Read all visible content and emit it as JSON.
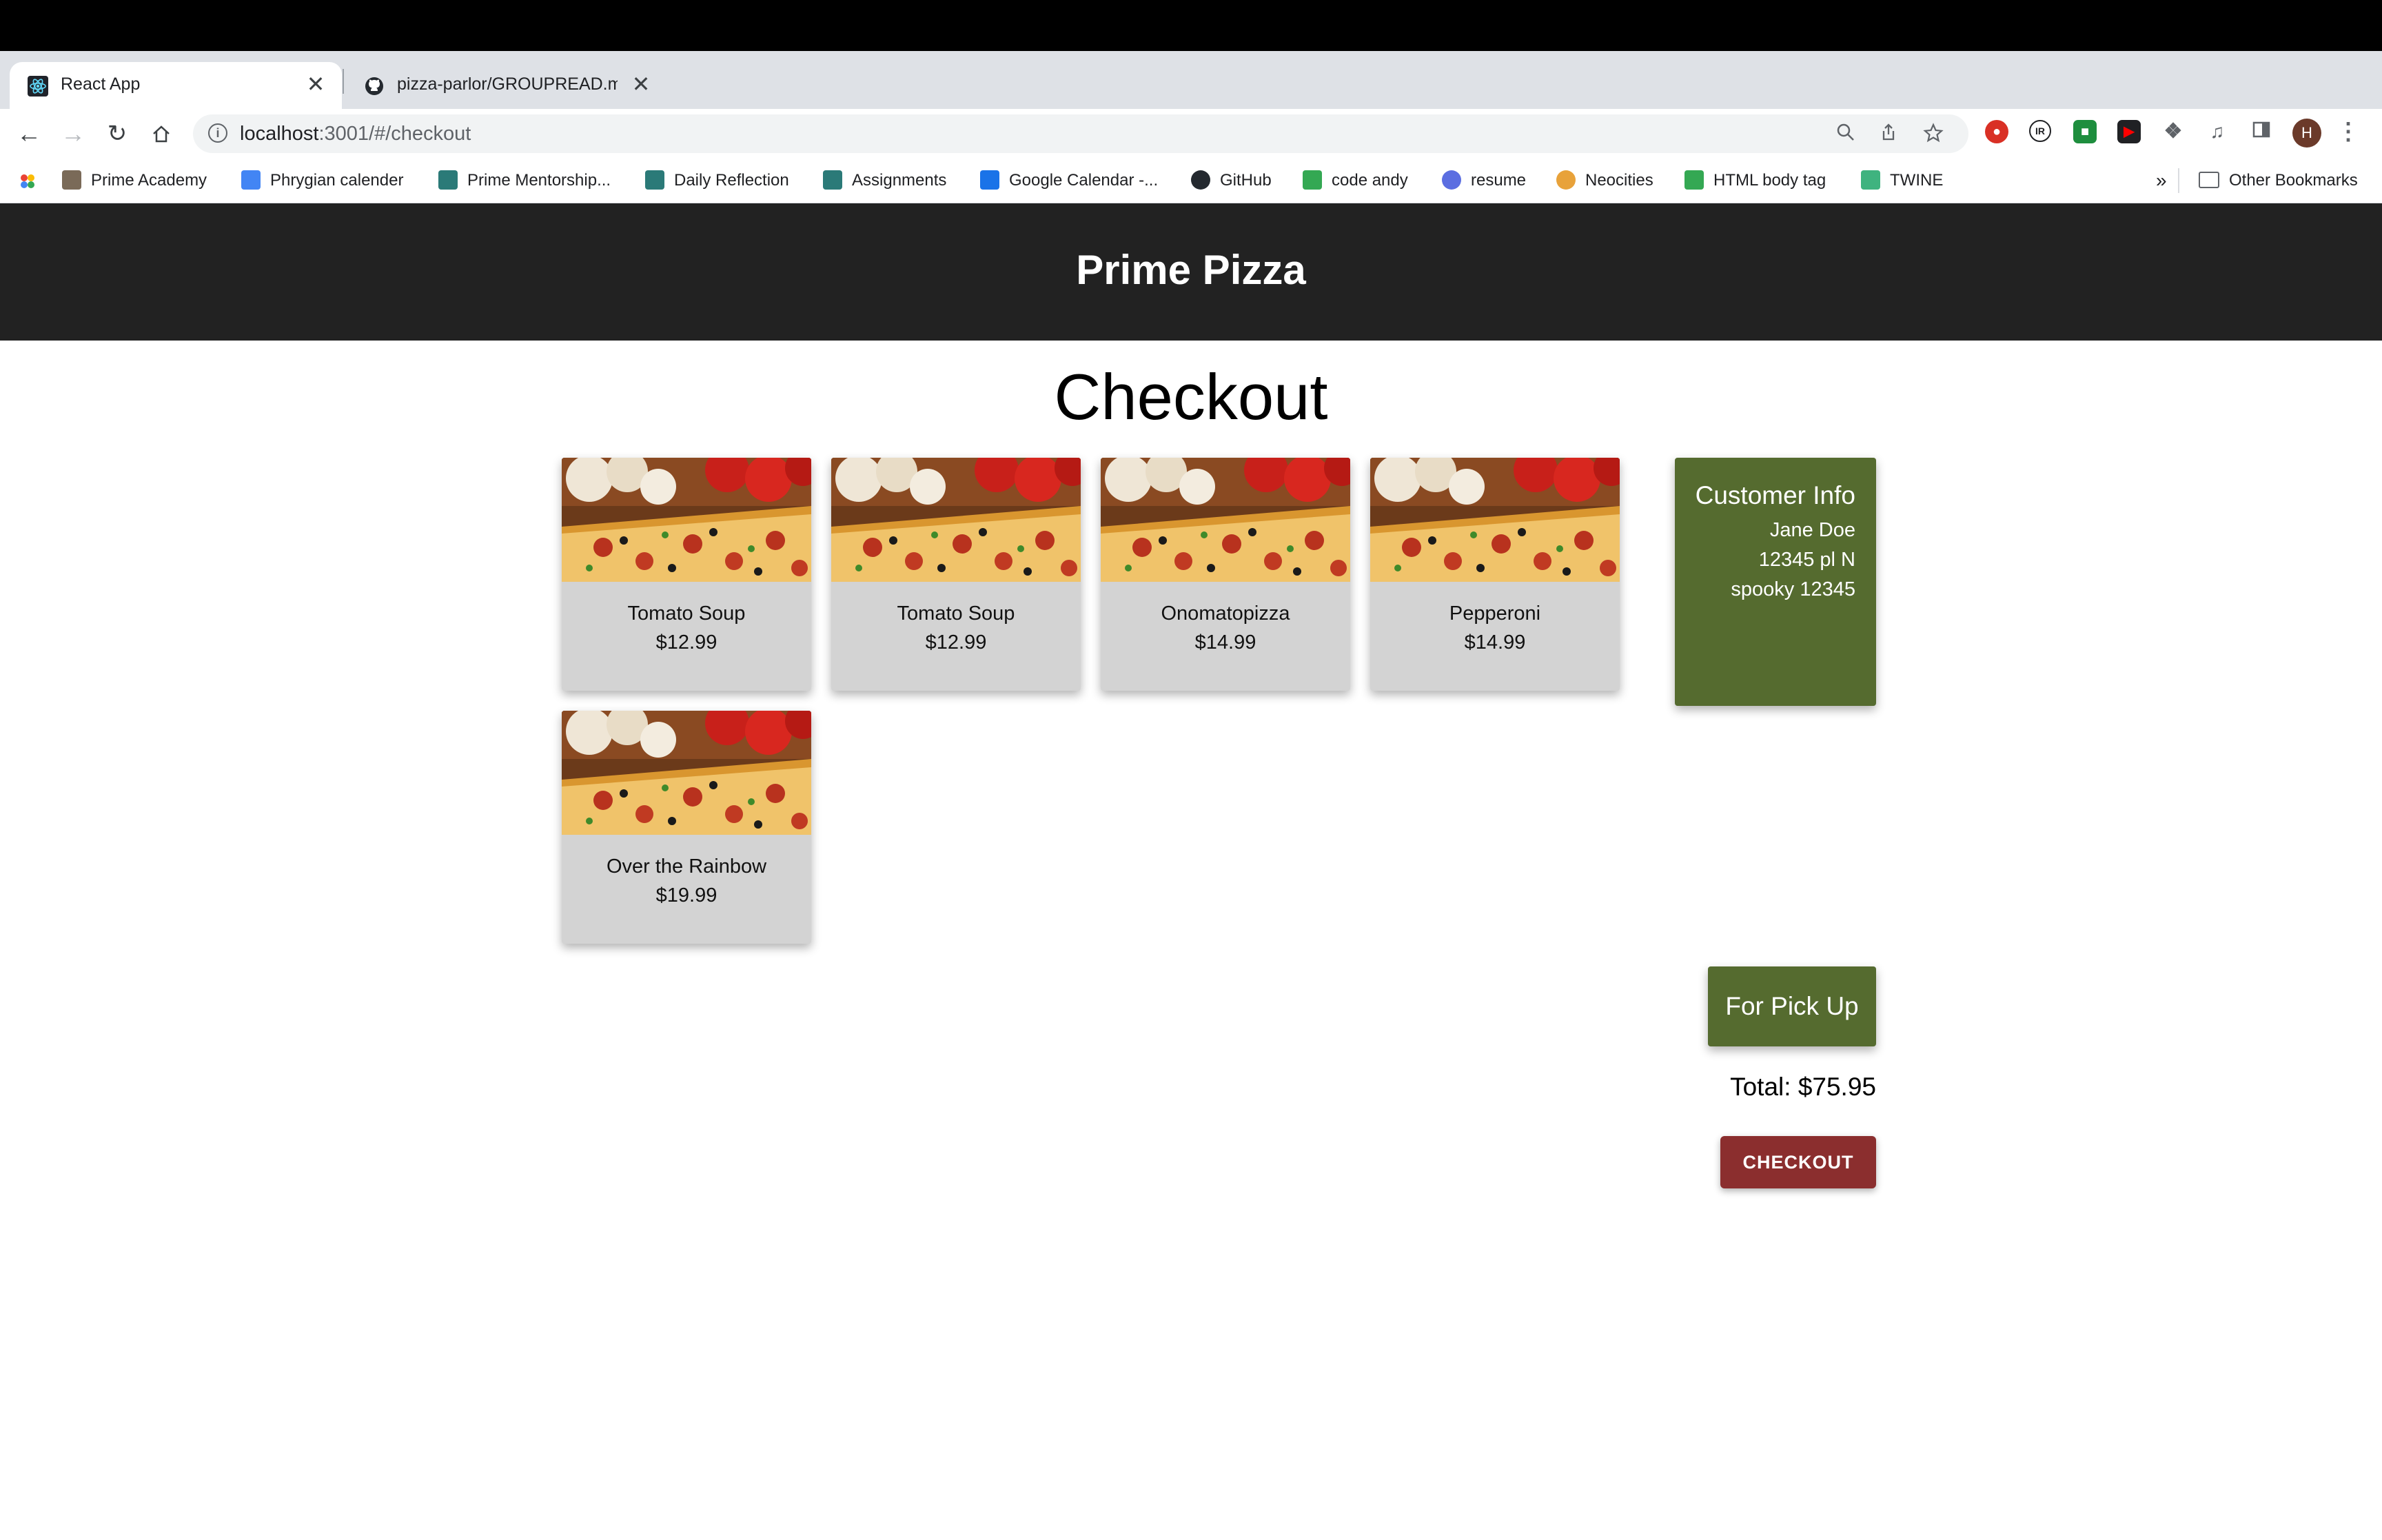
{
  "browser": {
    "tabs": [
      {
        "title": "React App",
        "close": "✕"
      },
      {
        "title": "pizza-parlor/GROUPREAD.md",
        "close": "✕"
      }
    ],
    "new_tab": "+",
    "tab_menu": "⌄",
    "url_host": "localhost",
    "url_path": ":3001/#/checkout",
    "avatar_letter": "H",
    "bookmarks": [
      "Prime Academy",
      "Phrygian calender",
      "Prime Mentorship...",
      "Daily Reflection",
      "Assignments",
      "Google Calendar -...",
      "GitHub",
      "code andy",
      "resume",
      "Neocities",
      "HTML body tag",
      "TWINE"
    ],
    "bookmarks_overflow": "»",
    "other_bookmarks": "Other Bookmarks"
  },
  "app": {
    "header_title": "Prime Pizza",
    "page_title": "Checkout",
    "cart": [
      {
        "name": "Tomato Soup",
        "price": "$12.99"
      },
      {
        "name": "Tomato Soup",
        "price": "$12.99"
      },
      {
        "name": "Onomatopizza",
        "price": "$14.99"
      },
      {
        "name": "Pepperoni",
        "price": "$14.99"
      },
      {
        "name": "Over the Rainbow",
        "price": "$19.99"
      }
    ],
    "customer": {
      "title": "Customer Info",
      "name": "Jane Doe",
      "street": "12345 pl N",
      "city_zip": "spooky 12345"
    },
    "order_type": "For Pick Up",
    "total": "Total: $75.95",
    "checkout_label": "CHECKOUT"
  },
  "colors": {
    "header_bg": "#222222",
    "card_bg": "#d3d3d3",
    "customer_bg": "#556b2f",
    "checkout_bg": "#8b2e2e"
  }
}
